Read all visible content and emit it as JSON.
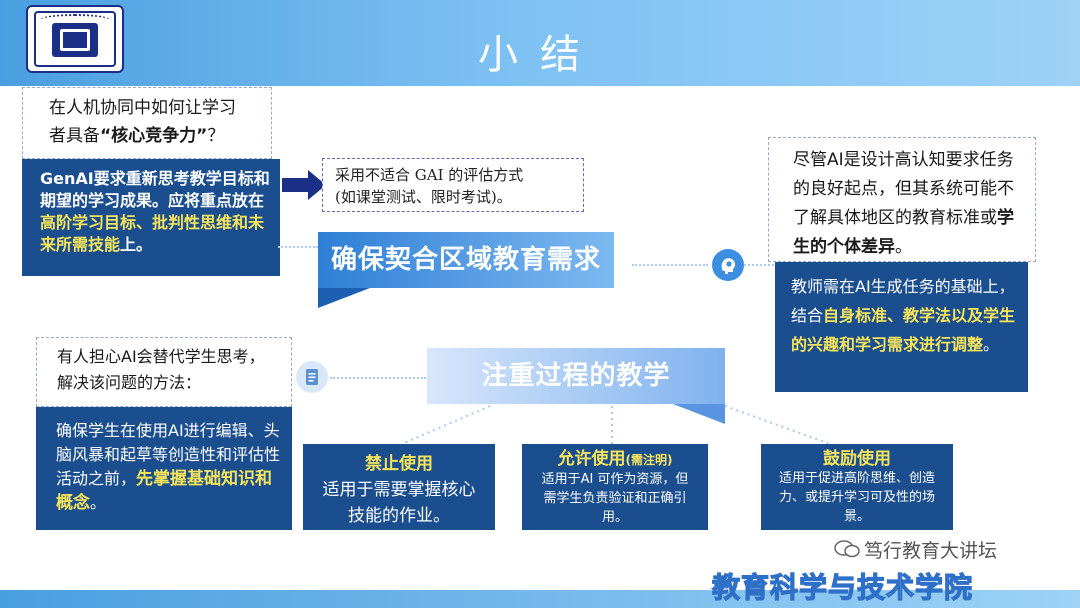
{
  "header": {
    "title": "小结",
    "colors": {
      "header_blue": "#4a9fe0",
      "panel_navy": "#1a4e8f",
      "highlight_yellow": "#f6e45b"
    }
  },
  "left_top": {
    "question_line1": "在人机协同中如何让学习",
    "question_line2_pre": "者具备",
    "question_emph": "“核心竞争力”",
    "question_line2_post": "？",
    "answer_pre": "GenAI要求重新思考教学目标和期望的学习成果。应将重点放在",
    "answer_hl": "高阶学习目标、批判性思维和未来所需技能",
    "answer_post": "上。"
  },
  "note1": {
    "line1": "采用不适合 GAI 的评估方式",
    "line2": "(如课堂测试、限时考试)。"
  },
  "banner1": {
    "label": "确保契合区域教育需求"
  },
  "right": {
    "question_pre": "尽管AI是设计高认知要求任务的良好起点，但其系统可能不了解具体地区的教育标准或",
    "question_emph": "学生的个体差异",
    "question_post": "。",
    "answer_pre": "教师需在AI生成任务的基础上，结合",
    "answer_hl": "自身标准、教学法以及学生的兴趣和学习需求进行调整",
    "answer_post": "。"
  },
  "left_mid": {
    "question_line1": "有人担心AI会替代学生思考，",
    "question_line2": "解决该问题的方法：",
    "answer_pre": "确保学生在使用AI进行编辑、头脑风暴和起草等创造性和评估性活动之前，",
    "answer_hl": "先掌握基础知识和概念",
    "answer_post": "。"
  },
  "banner2": {
    "label": "注重过程的教学"
  },
  "boxes": {
    "forbid": {
      "title": "禁止使用",
      "body": "适用于需要掌握核心技能的作业。"
    },
    "allow": {
      "title": "允许使用",
      "title_note": "(需注明)",
      "body": "适用于AI 可作为资源，但需学生负责验证和正确引用。"
    },
    "encourage": {
      "title": "鼓励使用",
      "body": "适用于促进高阶思维、创造力、或提升学习可及性的场景。"
    }
  },
  "watermark": {
    "label": "笃行教育大讲坛"
  },
  "footer": {
    "college": "教育科学与技术学院"
  },
  "icons": [
    "university-logo",
    "arrow-right-icon",
    "lightbulb-head-icon",
    "document-icon",
    "wechat-icon"
  ]
}
